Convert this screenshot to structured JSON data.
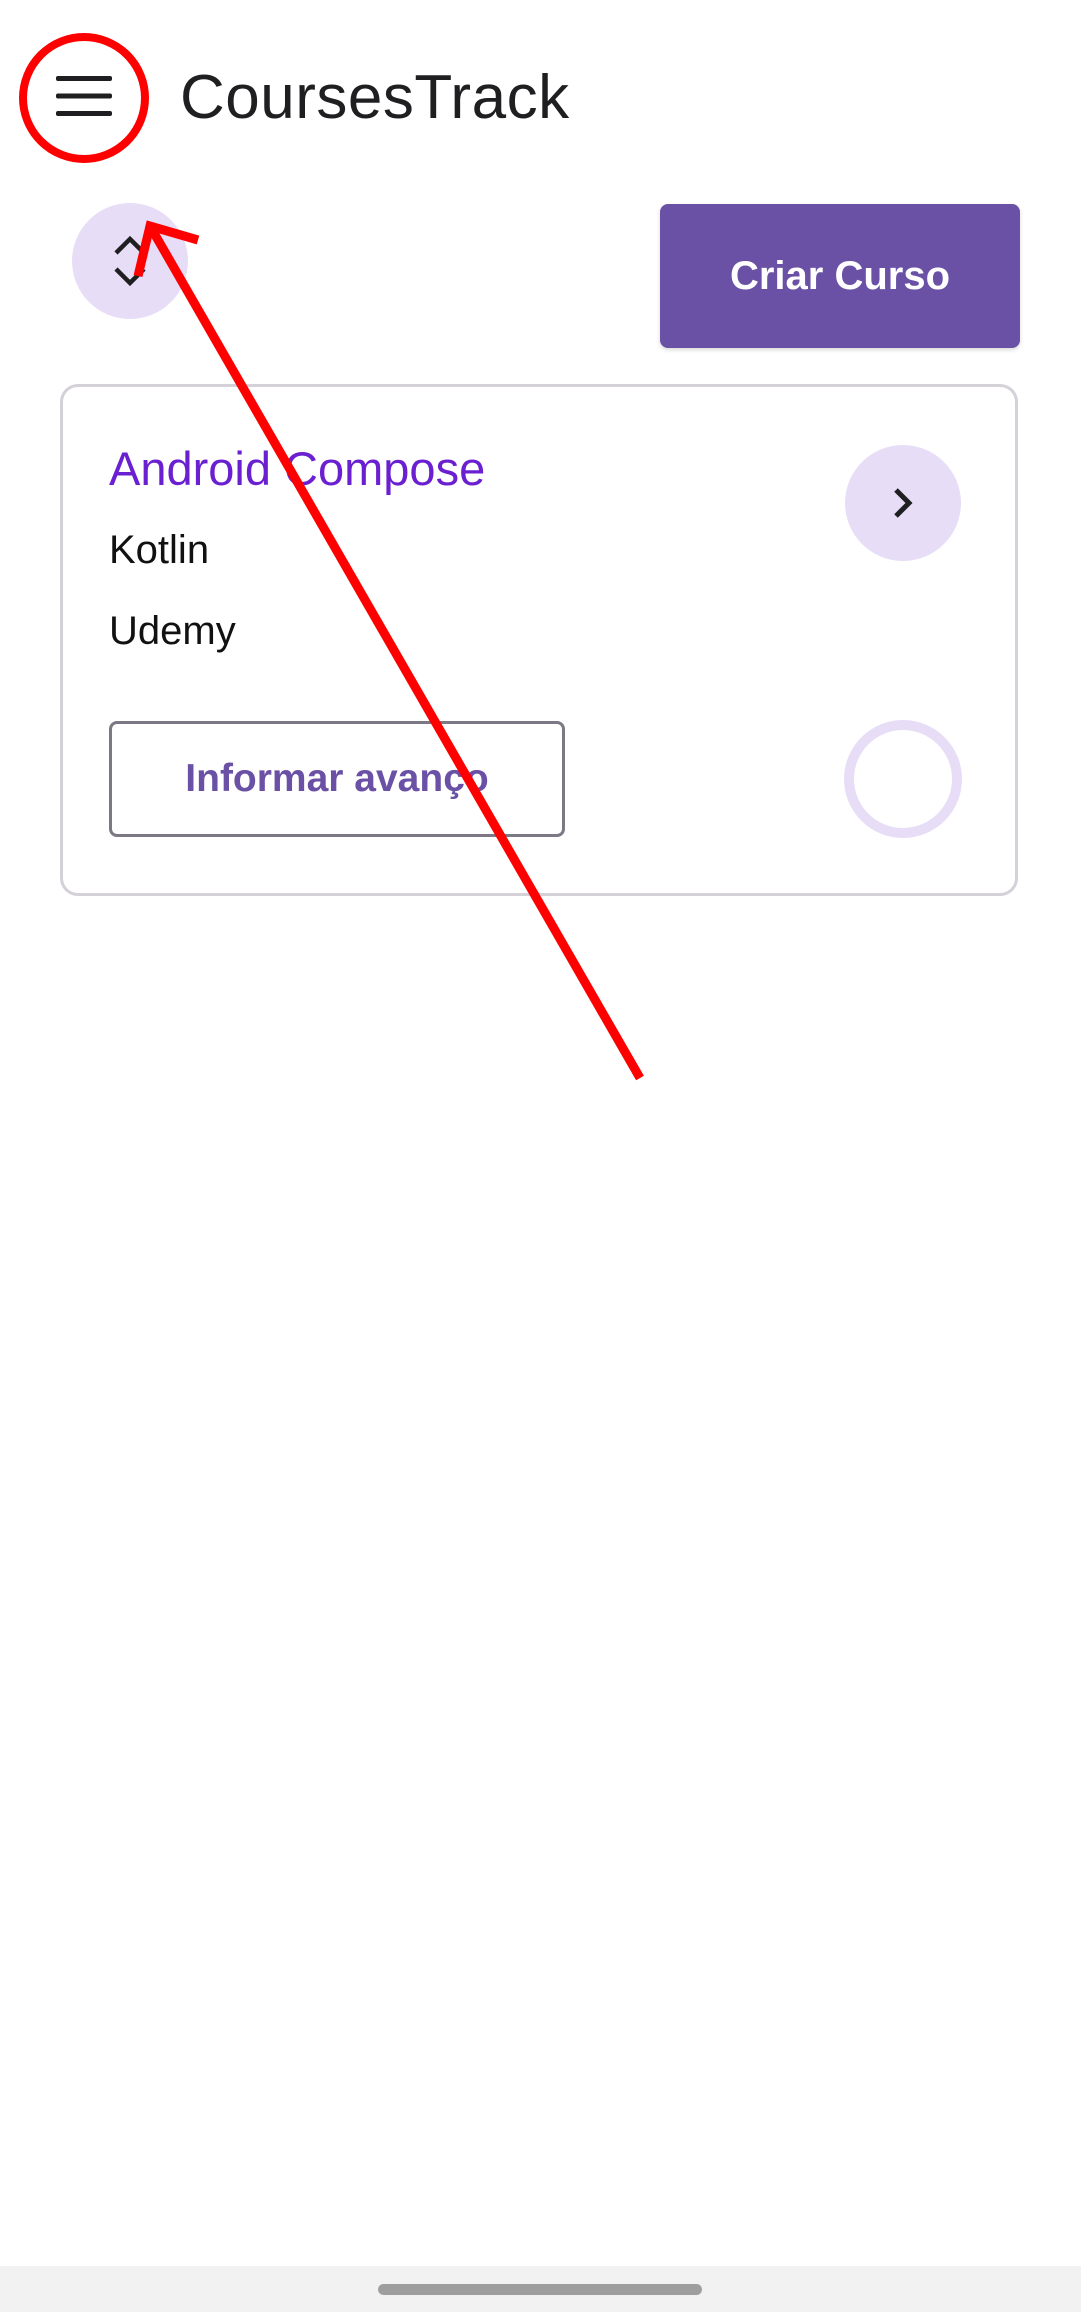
{
  "app_bar": {
    "title": "CoursesTrack",
    "menu_icon": "hamburger-menu-icon"
  },
  "toolbar": {
    "sort_icon": "sort-unfold-icon",
    "create_button_label": "Criar Curso"
  },
  "courses": [
    {
      "name": "Android Compose",
      "language": "Kotlin",
      "platform": "Udemy",
      "details_icon": "chevron-right-icon",
      "progress_button_label": "Informar avanço",
      "progress": 0
    }
  ],
  "colors": {
    "primary": "#6a51a5",
    "course_title": "#6a1fd0",
    "tonal_container": "#e8ddf7",
    "annotation": "#ff0000"
  }
}
